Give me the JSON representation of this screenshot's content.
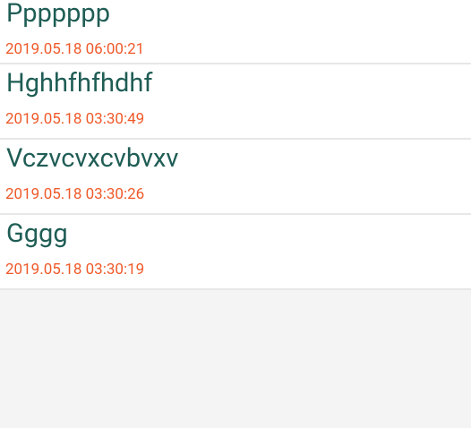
{
  "notes": [
    {
      "title": "Ppppppp",
      "timestamp": "2019.05.18 06:00:21"
    },
    {
      "title": "Hghhfhfhdhf",
      "timestamp": "2019.05.18 03:30:49"
    },
    {
      "title": "Vczvcvxcvbvxv",
      "timestamp": "2019.05.18 03:30:26"
    },
    {
      "title": "Gggg",
      "timestamp": "2019.05.18 03:30:19"
    }
  ]
}
